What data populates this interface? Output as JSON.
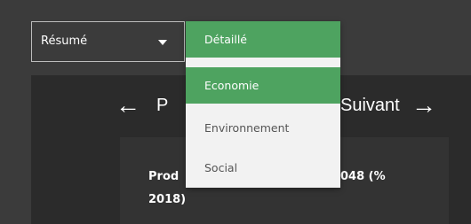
{
  "selector": {
    "value": "Résumé",
    "caret_icon": "caret-down-icon"
  },
  "dropdown": {
    "items": [
      {
        "label": "Détaillé"
      },
      {
        "label": "Economie"
      },
      {
        "label": "Environnement"
      },
      {
        "label": "Social"
      }
    ]
  },
  "nav": {
    "prev_label": "P",
    "next_label": "Suivant",
    "prev_icon": "arrow-left-icon",
    "next_icon": "arrow-right-icon"
  },
  "card": {
    "title_line1_left": "Prod",
    "title_line1_right": "048 (%",
    "title_line2": "2018)"
  },
  "colors": {
    "highlight": "#4ea360",
    "menu_bg": "#f2f2f2",
    "panel_bg": "#2b2b2b"
  }
}
